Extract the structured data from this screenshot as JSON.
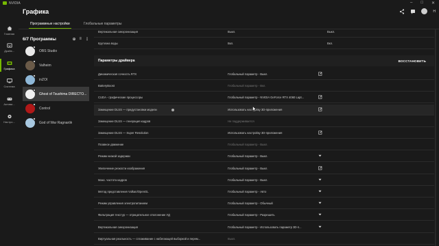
{
  "titlebar": {
    "app_name": "NVIDIA"
  },
  "header": {
    "title": "Графика",
    "help_label": "Н"
  },
  "nav_rail": [
    {
      "label": "Главная",
      "icon": "home-icon"
    },
    {
      "label": "Драйв...",
      "icon": "driver-icon"
    },
    {
      "label": "Графика",
      "icon": "graphics-icon",
      "active": true
    },
    {
      "label": "Система",
      "icon": "system-icon"
    },
    {
      "label": "Активи...",
      "icon": "activity-icon"
    },
    {
      "label": "Настро...",
      "icon": "settings-gear-icon"
    }
  ],
  "tabs": [
    {
      "label": "Программные настройки",
      "active": true
    },
    {
      "label": "Глобальные параметры",
      "active": false
    }
  ],
  "programs": {
    "count_label": "6/7 Программы",
    "items": [
      {
        "name": "OBS Studio",
        "color": "#e8e8e8"
      },
      {
        "name": "Valheim",
        "color": "#6a5a48"
      },
      {
        "name": "inZOI",
        "color": "#8fb8d8"
      },
      {
        "name": "Ghost of Tsushima DIRECTO...",
        "color": "#f0f0f0",
        "selected": true
      },
      {
        "name": "Control",
        "color": "#b01818"
      },
      {
        "name": "God of War Ragnarök",
        "color": "#a8c8e0"
      }
    ]
  },
  "top_rows": [
    {
      "name": "Вертикальная синхронизация",
      "value": "Выкл.",
      "value2": "Выкл."
    },
    {
      "name": "Крутизна воды",
      "value": "Вкл.",
      "value2": "Вкл."
    }
  ],
  "section": {
    "title": "Параметры драйвера",
    "restore_label": "ВОССТАНОВИТЬ"
  },
  "driver_rows": [
    {
      "name": "Динамическая сочность RTX",
      "value": "Глобальный параметр - Выкл.",
      "action": "edit"
    },
    {
      "name": "BatteryBoost",
      "value": "Глобальный параметр - Вкл.",
      "disabled": true
    },
    {
      "name": "CUDA - графические процессоры",
      "value": "Глобальный параметр - NVIDIA GeForce RTX 4060 Lapt...",
      "action": "edit"
    },
    {
      "name": "Замещение DLSS — предустановки модели",
      "value": "Использовать настройку 3D-приложения",
      "action": "edit",
      "info": true,
      "hover": true
    },
    {
      "name": "Замещение DLSS — генерация кадров",
      "value": "Не поддерживается",
      "disabled": true
    },
    {
      "name": "Замещение DLSS — Super Resolution",
      "value": "Использовать настройку 3D-приложения",
      "action": "edit"
    },
    {
      "name": "Плавное движение",
      "value": "Глобальный параметр - Выкл.",
      "disabled": true
    },
    {
      "name": "Режим низкой задержки",
      "value": "Глобальный параметр - Выкл.",
      "action": "dropdown"
    },
    {
      "name": "Увеличение резкости изображения",
      "value": "Глобальный параметр - Выкл.",
      "action": "edit"
    },
    {
      "name": "Макс. частота кадров",
      "value": "Глобальный параметр - Выкл.",
      "action": "dropdown"
    },
    {
      "name": "Метод представления Vulkan/OpenGL",
      "value": "Глобальный параметр - Авто",
      "action": "dropdown"
    },
    {
      "name": "Режим управления электропитанием",
      "value": "Глобальный параметр - Обычный",
      "action": "dropdown"
    },
    {
      "name": "Фильтрация текстур — отрицательное отклонение УД",
      "value": "Глобальный параметр - Разрешить",
      "action": "dropdown"
    },
    {
      "name": "Вертикальная синхронизация",
      "value": "Глобальный параметр - Использовать параметр 3D-п...",
      "action": "dropdown"
    },
    {
      "name": "Виртуальная реальность — сглаживание с набегающей выборкой и перем...",
      "value": "Выкл.",
      "disabled": true
    }
  ],
  "colors": {
    "accent": "#76b900",
    "background": "#1a1a1a",
    "section": "#202020"
  }
}
